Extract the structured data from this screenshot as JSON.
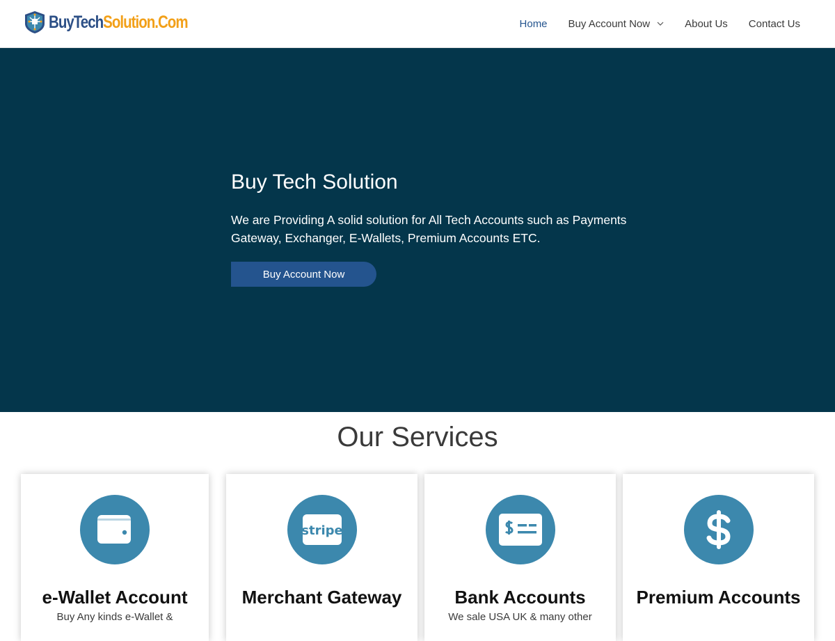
{
  "header": {
    "logo": {
      "part1": "BuyTech",
      "part2": "Solution.Com"
    },
    "nav": [
      {
        "label": "Home",
        "active": true
      },
      {
        "label": "Buy Account Now",
        "has_dropdown": true
      },
      {
        "label": "About Us"
      },
      {
        "label": "Contact Us"
      }
    ]
  },
  "hero": {
    "title": "Buy Tech Solution",
    "text": "We are Providing A solid solution for All Tech Accounts such as Payments Gateway, Exchanger, E-Wallets, Premium Accounts ETC.",
    "button_label": "Buy Account Now"
  },
  "services": {
    "title": "Our Services",
    "cards": [
      {
        "icon": "wallet-icon",
        "title": "e-Wallet Account",
        "desc": "Buy Any kinds e-Wallet &"
      },
      {
        "icon": "stripe-icon",
        "icon_text": "stripe",
        "title": "Merchant Gateway",
        "desc": ""
      },
      {
        "icon": "money-check-icon",
        "title": "Bank Accounts",
        "desc": "We sale USA UK & many other"
      },
      {
        "icon": "dollar-icon",
        "title": "Premium Accounts",
        "desc": ""
      }
    ]
  },
  "colors": {
    "hero_bg": "#04364b",
    "accent": "#24548e",
    "icon_circle": "#3c88ad",
    "logo_blue": "#2c4f86",
    "logo_orange": "#f2a019"
  }
}
